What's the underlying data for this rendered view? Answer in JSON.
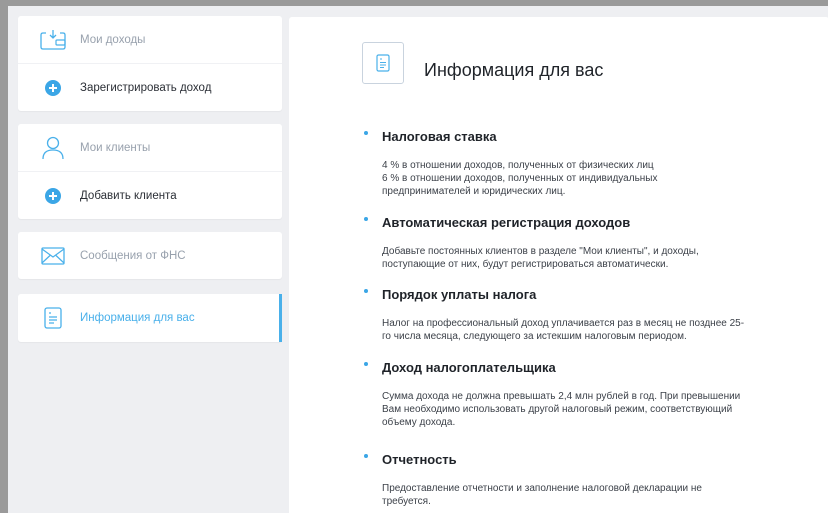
{
  "sidebar": {
    "groups": [
      {
        "items": [
          {
            "label": "Мои доходы",
            "icon": "wallet-icon"
          },
          {
            "label": "Зарегистрировать доход",
            "icon": "plus-icon"
          }
        ]
      },
      {
        "items": [
          {
            "label": "Мои клиенты",
            "icon": "user-icon"
          },
          {
            "label": "Добавить клиента",
            "icon": "plus-icon"
          }
        ]
      },
      {
        "items": [
          {
            "label": "Сообщения от ФНС",
            "icon": "envelope-icon"
          }
        ]
      },
      {
        "items": [
          {
            "label": "Информация для вас",
            "icon": "document-icon",
            "active": true
          }
        ]
      }
    ]
  },
  "main": {
    "title": "Информация для вас",
    "sections": [
      {
        "title": "Налоговая ставка",
        "lines": [
          "4 % в отношении доходов, полученных от физических лиц",
          "6 % в отношении доходов, полученных от индивидуальных",
          "предпринимателей и юридических лиц."
        ]
      },
      {
        "title": "Автоматическая регистрация доходов",
        "lines": [
          "Добавьте постоянных клиентов в разделе \"Мои клиенты\", и доходы,",
          "поступающие от них, будут регистрироваться автоматически."
        ]
      },
      {
        "title": "Порядок уплаты налога",
        "lines": [
          "Налог на профессиональный доход уплачивается раз в месяц не позднее 25-",
          "го числа месяца, следующего за истекшим налоговым периодом."
        ]
      },
      {
        "title": "Доход налогоплательщика",
        "lines": [
          "Сумма дохода не должна превышать 2,4 млн рублей в год. При превышении",
          "Вам необходимо использовать другой налоговый режим, соответствующий",
          "объему дохода."
        ]
      },
      {
        "title": "Отчетность",
        "lines": [
          "Предоставление отчетности и заполнение налоговой декларации не",
          "требуется."
        ]
      }
    ]
  },
  "colors": {
    "accent": "#3ba6e6",
    "background": "#eeeff2",
    "muted_text": "#98a1ad"
  }
}
